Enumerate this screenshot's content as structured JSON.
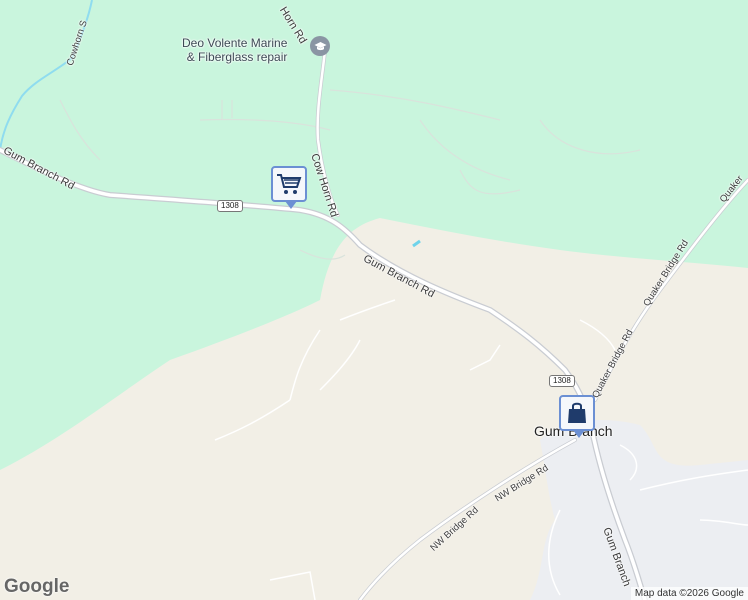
{
  "colors": {
    "forest": "#c9f5dd",
    "land": "#f2efe6",
    "urban": "#eceef2",
    "water": "#6fd3ea",
    "road": "#ffffff",
    "road_casing": "#c9ccd2",
    "pin_border": "#6b8fd3",
    "pin_icon": "#1f3b6b"
  },
  "pois": {
    "marine": {
      "name_line1": "Deo Volente Marine",
      "name_line2": "& Fiberglass repair",
      "icon": "school-cap-icon"
    },
    "shopping_pin": {
      "icon": "shopping-cart-icon"
    },
    "store_pin": {
      "icon": "shopping-bag-icon"
    }
  },
  "roads": {
    "gum_branch_rd_w": "Gum Branch Rd",
    "gum_branch_rd_e": "Gum Branch Rd",
    "cow_horn_rd": "Cow Horn Rd",
    "horn_rd_top": "Horn Rd",
    "cowhorn_s": "Cowhorn S",
    "quaker_bridge_rd_1": "Quaker Bridge Rd",
    "quaker_bridge_rd_2": "Quaker Bridge Rd",
    "quaker_top": "Quaker",
    "nw_bridge_rd_1": "NW Bridge Rd",
    "nw_bridge_rd_2": "NW Bridge Rd",
    "gum_branch_s": "Gum Branch"
  },
  "shields": {
    "s1": "1308",
    "s2": "1308"
  },
  "place": {
    "town": "Gum Branch"
  },
  "footer": {
    "logo": "Google",
    "attribution": "Map data ©2026 Google"
  }
}
